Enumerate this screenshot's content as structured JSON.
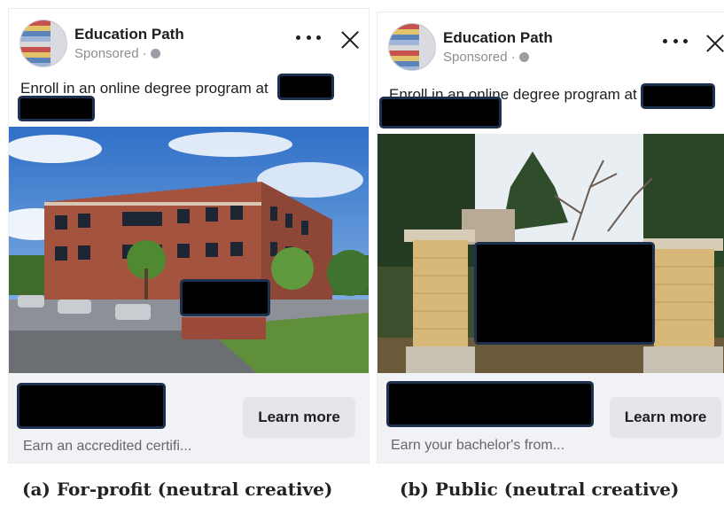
{
  "ads": [
    {
      "page_name": "Education Path",
      "sponsored": "Sponsored ·",
      "body_text": "Enroll in an online degree program at",
      "cta_label": "Learn more",
      "footer_subtext": "Earn an accredited certifi...",
      "caption": "(a) For-profit (neutral creative)"
    },
    {
      "page_name": "Education Path",
      "sponsored": "Sponsored ·",
      "body_text": "Enroll in an online degree program at",
      "cta_label": "Learn more",
      "footer_subtext": "Earn your bachelor's from...",
      "caption": "(b) Public (neutral creative)"
    }
  ],
  "icons": {
    "more": "more-options-icon",
    "close": "close-icon",
    "audience": "globe-icon"
  },
  "colors": {
    "redaction": "#000000",
    "redaction_border": "#1e3050",
    "footer_bg": "#f0f2f5",
    "button_bg": "#e4e6eb"
  }
}
